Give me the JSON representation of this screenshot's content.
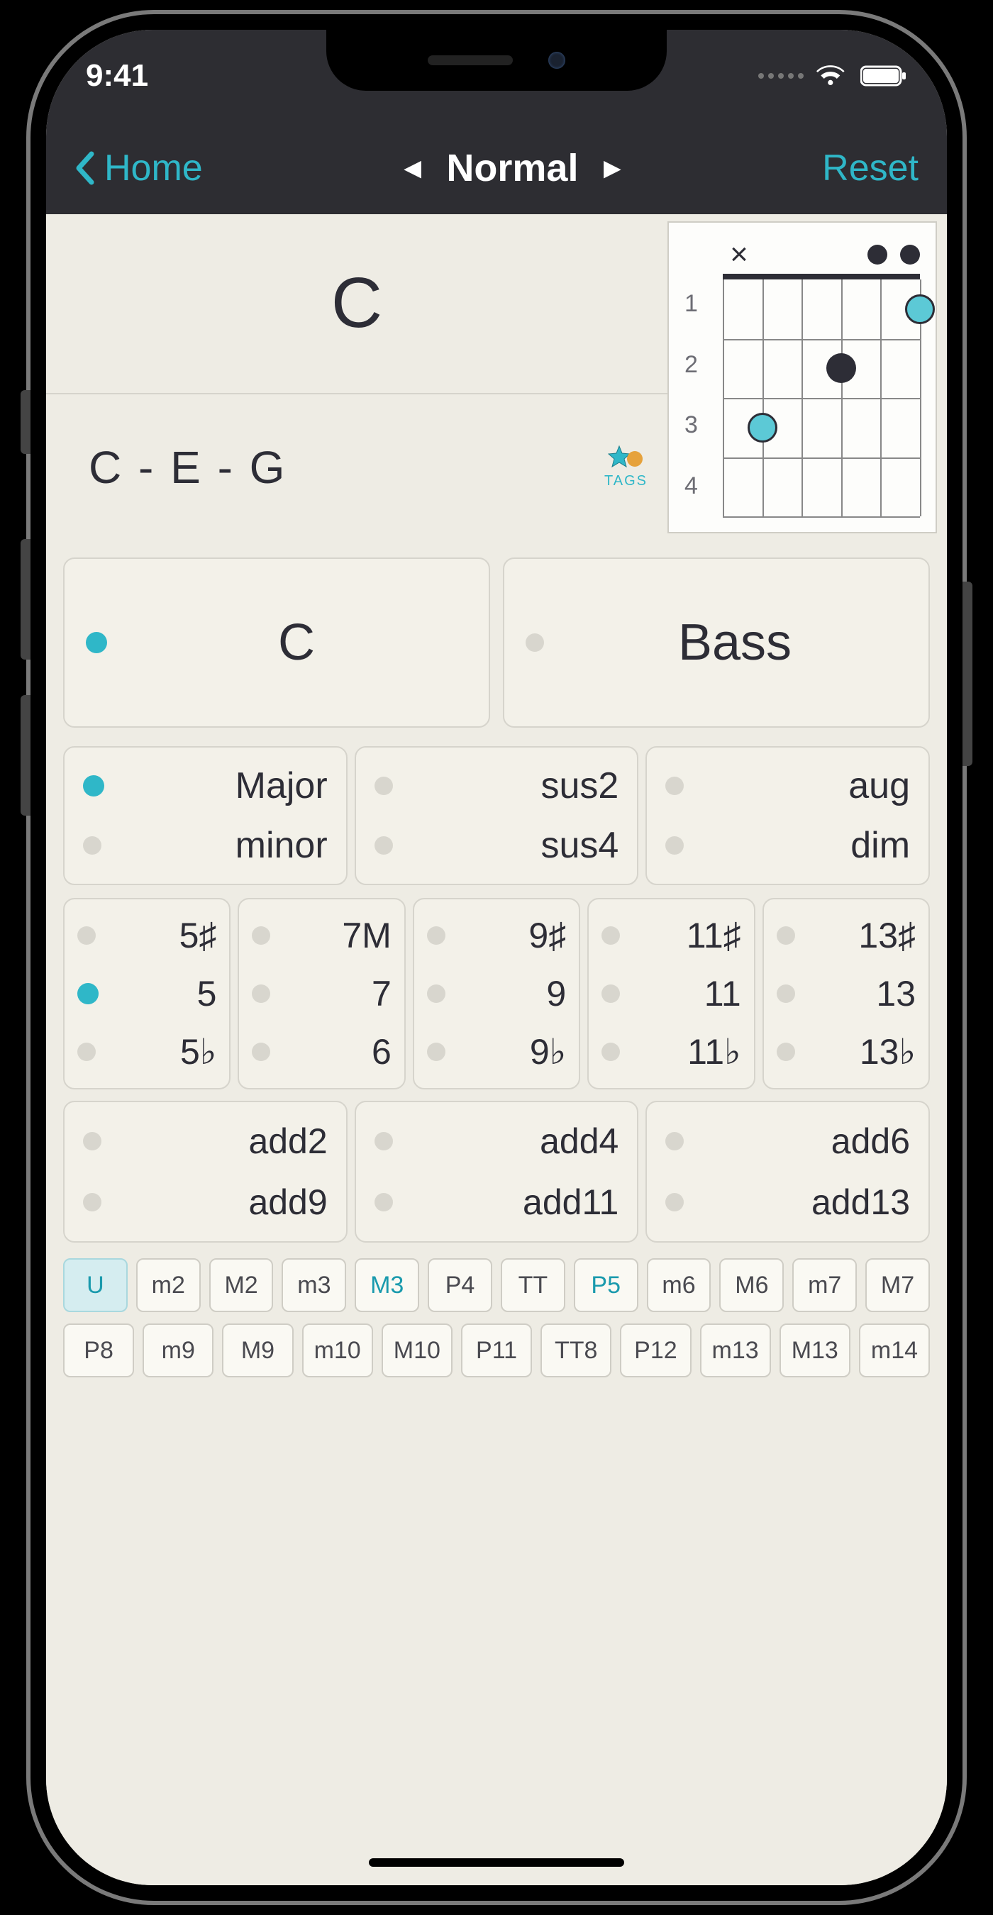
{
  "statusbar": {
    "time": "9:41"
  },
  "nav": {
    "back_label": "Home",
    "title": "Normal",
    "reset_label": "Reset"
  },
  "chord": {
    "name": "C",
    "notes": "C - E - G",
    "tags_label": "TAGS"
  },
  "diagram": {
    "top_markers": [
      "x",
      "",
      "",
      "",
      "open",
      "open"
    ],
    "fret_labels": [
      "1",
      "2",
      "3",
      "4"
    ],
    "fingers": [
      {
        "string": 5,
        "fret": 1,
        "color": "teal"
      },
      {
        "string": 3,
        "fret": 2,
        "color": "dark"
      },
      {
        "string": 1,
        "fret": 3,
        "color": "teal"
      }
    ]
  },
  "root_panel": {
    "label": "C",
    "on": true
  },
  "bass_panel": {
    "label": "Bass",
    "on": false
  },
  "quality": [
    [
      {
        "label": "Major",
        "on": true
      },
      {
        "label": "minor",
        "on": false
      }
    ],
    [
      {
        "label": "sus2",
        "on": false
      },
      {
        "label": "sus4",
        "on": false
      }
    ],
    [
      {
        "label": "aug",
        "on": false
      },
      {
        "label": "dim",
        "on": false
      }
    ]
  ],
  "extensions": [
    [
      {
        "label": "5♯",
        "on": false
      },
      {
        "label": "5",
        "on": true
      },
      {
        "label": "5♭",
        "on": false
      }
    ],
    [
      {
        "label": "7M",
        "on": false
      },
      {
        "label": "7",
        "on": false
      },
      {
        "label": "6",
        "on": false
      }
    ],
    [
      {
        "label": "9♯",
        "on": false
      },
      {
        "label": "9",
        "on": false
      },
      {
        "label": "9♭",
        "on": false
      }
    ],
    [
      {
        "label": "11♯",
        "on": false
      },
      {
        "label": "11",
        "on": false
      },
      {
        "label": "11♭",
        "on": false
      }
    ],
    [
      {
        "label": "13♯",
        "on": false
      },
      {
        "label": "13",
        "on": false
      },
      {
        "label": "13♭",
        "on": false
      }
    ]
  ],
  "adds": [
    [
      {
        "label": "add2",
        "on": false
      },
      {
        "label": "add9",
        "on": false
      }
    ],
    [
      {
        "label": "add4",
        "on": false
      },
      {
        "label": "add11",
        "on": false
      }
    ],
    [
      {
        "label": "add6",
        "on": false
      },
      {
        "label": "add13",
        "on": false
      }
    ]
  ],
  "intervals": {
    "row1": [
      {
        "label": "U",
        "state": "on"
      },
      {
        "label": "m2",
        "state": ""
      },
      {
        "label": "M2",
        "state": ""
      },
      {
        "label": "m3",
        "state": ""
      },
      {
        "label": "M3",
        "state": "hl"
      },
      {
        "label": "P4",
        "state": ""
      },
      {
        "label": "TT",
        "state": ""
      },
      {
        "label": "P5",
        "state": "hl"
      },
      {
        "label": "m6",
        "state": ""
      },
      {
        "label": "M6",
        "state": ""
      },
      {
        "label": "m7",
        "state": ""
      },
      {
        "label": "M7",
        "state": ""
      }
    ],
    "row2": [
      {
        "label": "P8",
        "state": ""
      },
      {
        "label": "m9",
        "state": ""
      },
      {
        "label": "M9",
        "state": ""
      },
      {
        "label": "m10",
        "state": ""
      },
      {
        "label": "M10",
        "state": ""
      },
      {
        "label": "P11",
        "state": ""
      },
      {
        "label": "TT8",
        "state": ""
      },
      {
        "label": "P12",
        "state": ""
      },
      {
        "label": "m13",
        "state": ""
      },
      {
        "label": "M13",
        "state": ""
      },
      {
        "label": "m14",
        "state": ""
      }
    ]
  }
}
